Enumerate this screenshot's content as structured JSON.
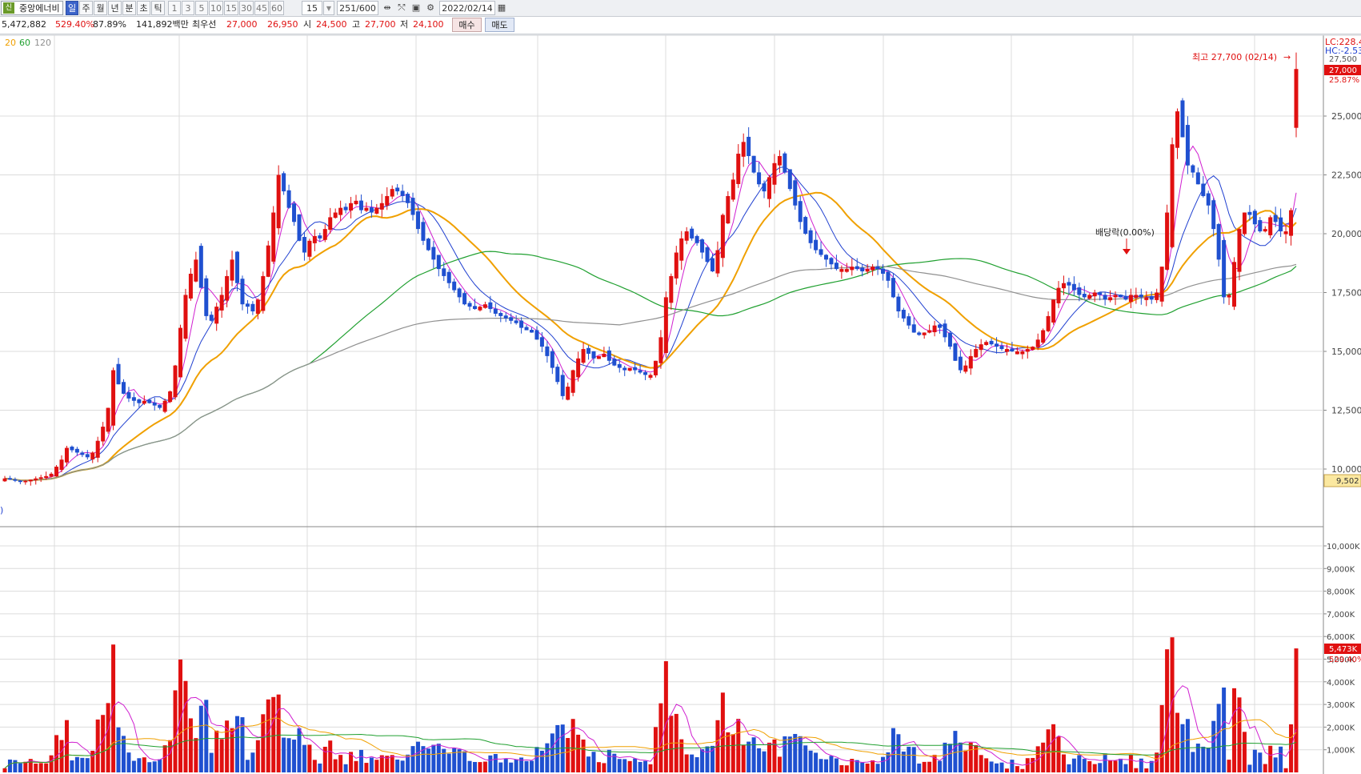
{
  "toolbar": {
    "stock_badge": "신",
    "stock_name": "중앙에너비",
    "period_tabs": [
      "일",
      "주",
      "월",
      "년",
      "분",
      "초",
      "틱"
    ],
    "active_period": "일",
    "interval_options": [
      "1",
      "3",
      "5",
      "10",
      "15",
      "30",
      "45",
      "60"
    ],
    "interval_value": "15",
    "count_display": "251",
    "count_total": "/600",
    "date_value": "2022/02/14"
  },
  "info": {
    "volume": "5,472,882",
    "volume_ratio": "529.40%",
    "turnover_ratio": "87.89%",
    "trade_amount": "141,892백만",
    "best_ask_label": "최우선",
    "best_ask": "27,000",
    "best_bid": "26,950",
    "open_label": "시",
    "open": "24,500",
    "high_label": "고",
    "high": "27,700",
    "low_label": "저",
    "low": "24,100",
    "buy_label": "매수",
    "sell_label": "매도"
  },
  "legend": {
    "ma20": "20",
    "ma60": "60",
    "ma120": "120"
  },
  "annotations": {
    "high_marker": "최고 27,700 (02/14)",
    "dividend": "배당락(0.00%)",
    "left_cut_label": ")"
  },
  "right_axis": {
    "lc_label": "LC:228.4",
    "hc_label": "HC:-2.53",
    "top_cut_label": "27,500",
    "current_price_tag": "27,000",
    "change_pct_tag": "25.87%",
    "low_tag": "9,502",
    "volume_tag": "5,473K",
    "volume_pct_tag": "529.40%"
  },
  "colors": {
    "up": "#e01010",
    "down": "#1f50d0",
    "ma5": "#d020d0",
    "ma10": "#2040d0",
    "ma20": "#f0a000",
    "ma60": "#20a030",
    "ma120": "#909090",
    "grid": "#dcdcdc"
  },
  "chart_data": {
    "type": "candlestick",
    "date": "2022/02/14",
    "price_axis": {
      "ticks": [
        10000,
        12500,
        15000,
        17500,
        20000,
        22500,
        25000
      ],
      "tick_labels": [
        "10,000",
        "12,500",
        "15,000",
        "17,500",
        "20,000",
        "22,500",
        "25,000"
      ]
    },
    "volume_axis": {
      "ticks_k": [
        1000,
        2000,
        3000,
        4000,
        5000,
        6000,
        7000,
        8000,
        9000,
        10000
      ],
      "tick_labels": [
        "1,000K",
        "2,000K",
        "3,000K",
        "4,000K",
        "5,000K",
        "6,000K",
        "7,000K",
        "8,000K",
        "9,000K",
        "10,000K"
      ]
    },
    "last_candle": {
      "open": 24500,
      "high": 27700,
      "low": 24100,
      "close": 27000,
      "volume_k": 5473
    },
    "moving_averages": [
      "5",
      "10",
      "20",
      "60",
      "120"
    ],
    "price_series": [
      9600,
      9550,
      9500,
      9450,
      9500,
      9550,
      9600,
      9650,
      9700,
      9800,
      10100,
      10400,
      10900,
      10800,
      10700,
      10600,
      10500,
      10700,
      11200,
      11800,
      12600,
      14200,
      13600,
      13200,
      13000,
      12900,
      12800,
      12900,
      12800,
      12700,
      12600,
      12900,
      13300,
      14400,
      16000,
      17400,
      18300,
      18900,
      17700,
      16500,
      16300,
      16900,
      17400,
      18200,
      18900,
      17900,
      17000,
      16900,
      16700,
      17200,
      18200,
      19500,
      20900,
      22500,
      21800,
      21100,
      20500,
      19700,
      19200,
      19700,
      19900,
      19800,
      20200,
      20700,
      20900,
      21100,
      21000,
      21300,
      21400,
      21000,
      21100,
      20900,
      21100,
      21300,
      21600,
      21900,
      21800,
      21600,
      21300,
      20800,
      20200,
      19700,
      19300,
      18900,
      18500,
      18200,
      17900,
      17600,
      17300,
      17000,
      16900,
      16800,
      16900,
      17000,
      16800,
      16600,
      16500,
      16400,
      16300,
      16200,
      16000,
      15900,
      15800,
      15500,
      15200,
      14800,
      14300,
      13700,
      13100,
      13500,
      14200,
      14700,
      15100,
      14900,
      14700,
      14800,
      14900,
      14600,
      14400,
      14300,
      14200,
      14300,
      14200,
      14100,
      14000,
      14000,
      14600,
      15600,
      17300,
      18200,
      19200,
      19800,
      20100,
      19800,
      19600,
      19200,
      18800,
      18400,
      19300,
      20800,
      21600,
      22300,
      23400,
      23900,
      23300,
      22600,
      22100,
      21800,
      22400,
      23000,
      23300,
      22600,
      21900,
      21200,
      20500,
      20000,
      19600,
      19300,
      19100,
      18900,
      18700,
      18500,
      18500,
      18500,
      18600,
      18500,
      18400,
      18500,
      18600,
      18500,
      18300,
      18000,
      17300,
      16700,
      16400,
      16100,
      15800,
      15700,
      15800,
      15900,
      16100,
      16000,
      15600,
      15200,
      14600,
      14200,
      14400,
      14800,
      15100,
      15300,
      15400,
      15300,
      15200,
      15100,
      15100,
      15000,
      15000,
      15000,
      15100,
      15200,
      15500,
      15900,
      16500,
      17200,
      17700,
      17900,
      17800,
      17600,
      17400,
      17300,
      17400,
      17500,
      17400,
      17200,
      17300,
      17400,
      17300,
      17200,
      17400,
      17400,
      17300,
      17300,
      17200,
      17500,
      18600,
      20900,
      23800,
      25200,
      24100,
      22900,
      22600,
      22100,
      21600,
      21200,
      20200,
      18900,
      17300,
      17400,
      18800,
      20200,
      20900,
      20800,
      20400,
      20100,
      20200,
      20700,
      20500,
      20100,
      20100,
      21000,
      27000
    ]
  }
}
